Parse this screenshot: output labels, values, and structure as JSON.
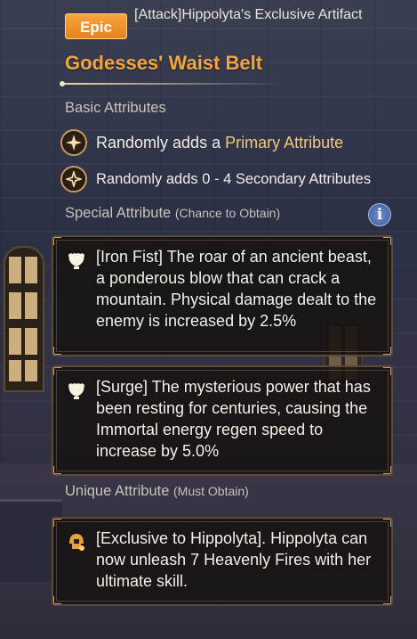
{
  "header": {
    "rarity_badge": "Epic",
    "category": "[Attack]Hippolyta's Exclusive Artifact",
    "item_title": "Godesses' Waist Belt"
  },
  "basic": {
    "label": "Basic Attributes",
    "rows": [
      {
        "icon": "sparkle-icon",
        "prefix": "Randomly adds a ",
        "highlight": "Primary Attribute"
      },
      {
        "icon": "sparkle-outline-icon",
        "text": "Randomly adds 0 - 4 Secondary Attributes"
      }
    ]
  },
  "special": {
    "label": "Special Attribute",
    "sublabel": "(Chance to Obtain)",
    "cards": [
      {
        "icon": "fist-icon",
        "text": "[Iron Fist] The roar of an ancient beast, a ponderous blow that can crack a mountain. Physical damage dealt to the enemy is increased by 2.5%"
      },
      {
        "icon": "fist-icon",
        "text": "[Surge] The mysterious power that has been resting for centuries, causing the Immortal energy regen speed to increase by 5.0%"
      }
    ]
  },
  "unique": {
    "label": "Unique Attribute",
    "sublabel": "(Must Obtain)",
    "cards": [
      {
        "icon": "helmet-icon",
        "text": "[Exclusive to Hippolyta]. Hippolyta can now unleash 7 Heavenly Fires with her ultimate skill."
      }
    ]
  },
  "colors": {
    "accent_orange": "#f4a43c",
    "highlight_gold": "#f4c77a",
    "badge_epic": "#ef9430"
  }
}
